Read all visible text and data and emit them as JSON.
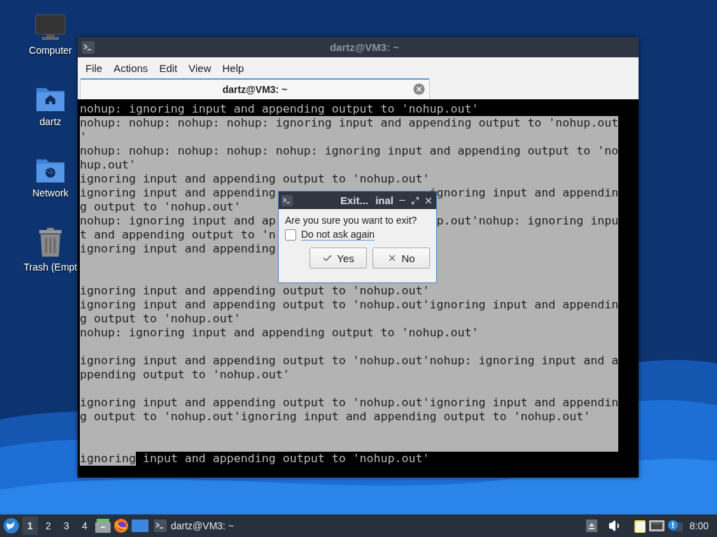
{
  "desktop": {
    "icons": [
      {
        "label": "Computer",
        "kind": "computer"
      },
      {
        "label": "dartz",
        "kind": "home"
      },
      {
        "label": "Network",
        "kind": "network"
      },
      {
        "label": "Trash (Empt",
        "kind": "trash"
      }
    ]
  },
  "window": {
    "title": "dartz@VM3: ~",
    "menu": [
      "File",
      "Actions",
      "Edit",
      "View",
      "Help"
    ],
    "tabs": [
      {
        "label": "dartz@VM3: ~",
        "selected": true
      }
    ],
    "terminal": {
      "lines": [
        {
          "text": "nohup: ignoring input and appending output to 'nohup.out'",
          "selected": false
        },
        {
          "text": "nohup: nohup: nohup: nohup: ignoring input and appending output to 'nohup.out",
          "selected": true
        },
        {
          "text": "'",
          "selected": true
        },
        {
          "text": "nohup: nohup: nohup: nohup: nohup: ignoring input and appending output to 'no",
          "selected": true
        },
        {
          "text": "hup.out'",
          "selected": true
        },
        {
          "text": "ignoring input and appending output to 'nohup.out'",
          "selected": true
        },
        {
          "text": "ignoring input and appending",
          "tail": "ignoring input and appendin",
          "selected": true
        },
        {
          "text": "g output to 'nohup.out'",
          "selected": true
        },
        {
          "text": "nohup: ignoring input and ap",
          "tail": "p.out'nohup: ignoring inpu",
          "selected": true
        },
        {
          "text": "t and appending output to 'n",
          "selected": true
        },
        {
          "text": "ignoring input and appending",
          "selected": true
        },
        {
          "selected": true
        },
        {
          "selected": true
        },
        {
          "text": "ignoring input and appending output to 'nohup.out'",
          "selected": true
        },
        {
          "text": "ignoring input and appending output to 'nohup.out'ignoring input and appendin",
          "selected": true
        },
        {
          "text": "g output to 'nohup.out'",
          "selected": true
        },
        {
          "text": "nohup: ignoring input and appending output to 'nohup.out'",
          "selected": true
        },
        {
          "selected": true
        },
        {
          "text": "ignoring input and appending output to 'nohup.out'nohup: ignoring input and a",
          "selected": true
        },
        {
          "text": "ppending output to 'nohup.out'",
          "selected": true
        },
        {
          "selected": true
        },
        {
          "text": "ignoring input and appending output to 'nohup.out'ignoring input and appendin",
          "selected": true
        },
        {
          "text": "g output to 'nohup.out'ignoring input and appending output to 'nohup.out'",
          "selected": true
        },
        {
          "selected": true
        },
        {
          "selected": true
        },
        {
          "selection": "ignoring",
          "text": "input and appending output to 'nohup.out'",
          "selected": false
        }
      ]
    }
  },
  "dialog": {
    "title": "Exit... inal",
    "message": "Are you sure you want to exit?",
    "checkbox": {
      "label": "Do not ask again",
      "checked": false
    },
    "buttons": [
      {
        "label": "Yes",
        "kind": "confirm"
      },
      {
        "label": "No",
        "kind": "cancel"
      }
    ]
  },
  "taskbar": {
    "workspaces": [
      {
        "label": "1",
        "selected": true
      },
      {
        "label": "2",
        "selected": false
      },
      {
        "label": "3",
        "selected": false
      },
      {
        "label": "4",
        "selected": false
      }
    ],
    "tasks": [
      {
        "label": "dartz@VM3: ~"
      }
    ],
    "clock": "8:00"
  }
}
